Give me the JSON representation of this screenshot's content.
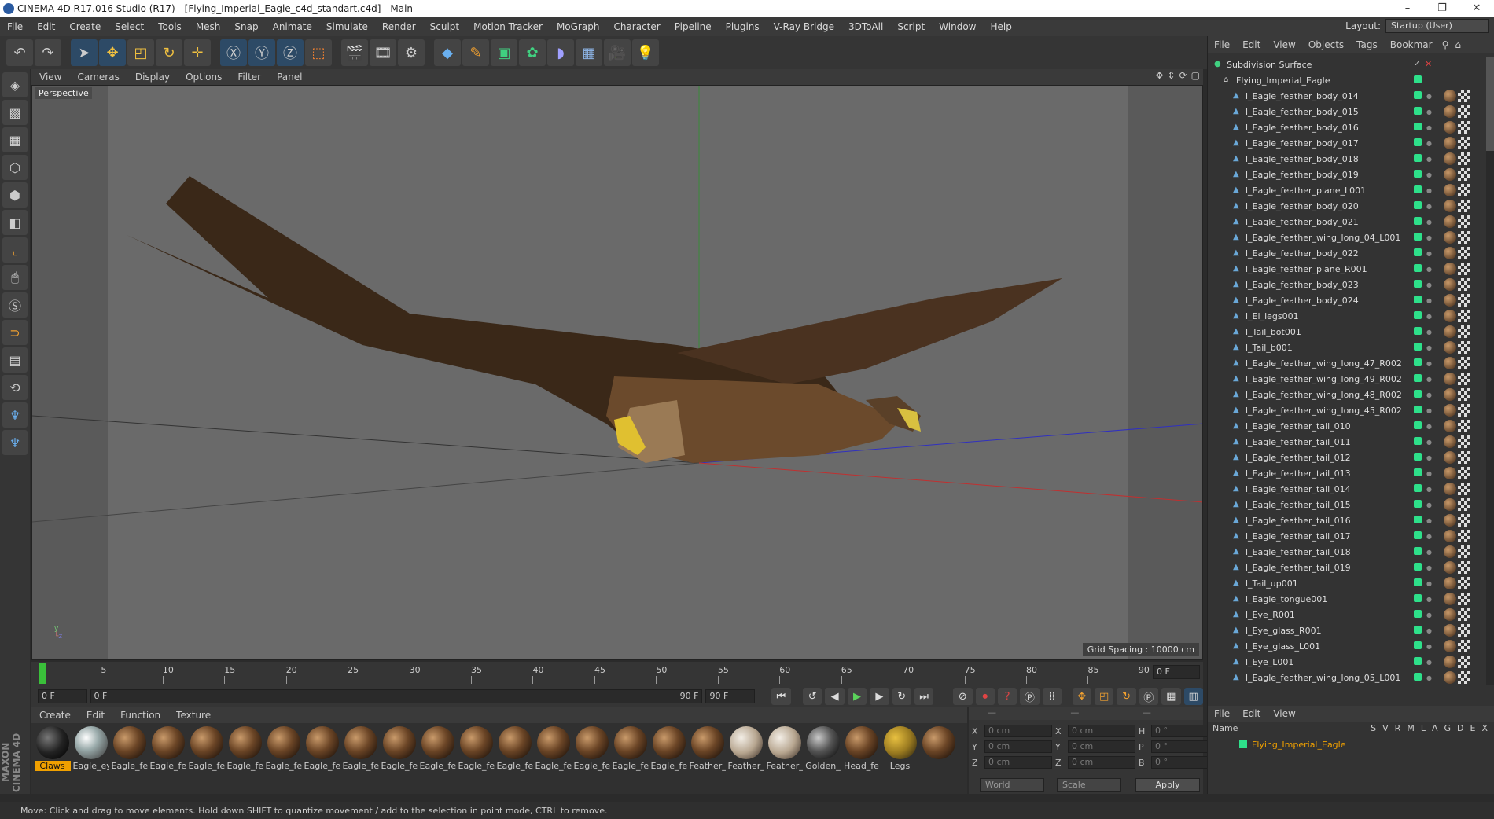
{
  "window": {
    "title": "CINEMA 4D R17.016 Studio (R17) - [Flying_Imperial_Eagle_c4d_standart.c4d] - Main",
    "minimize": "–",
    "restore": "❐",
    "close": "✕"
  },
  "menu": [
    "File",
    "Edit",
    "Create",
    "Select",
    "Tools",
    "Mesh",
    "Snap",
    "Animate",
    "Simulate",
    "Render",
    "Sculpt",
    "Motion Tracker",
    "MoGraph",
    "Character",
    "Pipeline",
    "Plugins",
    "V-Ray Bridge",
    "3DToAll",
    "Script",
    "Window",
    "Help"
  ],
  "layout": {
    "label": "Layout:",
    "value": "Startup (User)"
  },
  "viewport": {
    "menu": [
      "View",
      "Cameras",
      "Display",
      "Options",
      "Filter",
      "Panel"
    ],
    "label": "Perspective",
    "grid_spacing": "Grid Spacing : 10000 cm"
  },
  "timeline": {
    "ticks": [
      "0",
      "5",
      "10",
      "15",
      "20",
      "25",
      "30",
      "35",
      "40",
      "45",
      "50",
      "55",
      "60",
      "65",
      "70",
      "75",
      "80",
      "85",
      "90"
    ],
    "current_frame": "0 F"
  },
  "transport": {
    "start": "0 F",
    "range_start": "0 F",
    "range_end": "90 F",
    "end": "90 F"
  },
  "materials": {
    "menu": [
      "Create",
      "Edit",
      "Function",
      "Texture"
    ],
    "items": [
      {
        "label": "Claws",
        "style": "dark",
        "selected": true
      },
      {
        "label": "Eagle_ey",
        "style": "glass"
      },
      {
        "label": "Eagle_fe",
        "style": "brown"
      },
      {
        "label": "Eagle_fe",
        "style": "brown"
      },
      {
        "label": "Eagle_fe",
        "style": "brown"
      },
      {
        "label": "Eagle_fe",
        "style": "brown"
      },
      {
        "label": "Eagle_fe",
        "style": "brown"
      },
      {
        "label": "Eagle_fe",
        "style": "brown"
      },
      {
        "label": "Eagle_fe",
        "style": "brown"
      },
      {
        "label": "Eagle_fe",
        "style": "brown"
      },
      {
        "label": "Eagle_fe",
        "style": "brown"
      },
      {
        "label": "Eagle_fe",
        "style": "brown"
      },
      {
        "label": "Eagle_fe",
        "style": "brown"
      },
      {
        "label": "Eagle_fe",
        "style": "brown"
      },
      {
        "label": "Eagle_fe",
        "style": "brown"
      },
      {
        "label": "Eagle_fe",
        "style": "brown"
      },
      {
        "label": "Eagle_fe",
        "style": "brown"
      },
      {
        "label": "Feather_",
        "style": "brown"
      },
      {
        "label": "Feather_",
        "style": "light"
      },
      {
        "label": "Feather_",
        "style": "light"
      },
      {
        "label": "Golden_",
        "style": "golden"
      },
      {
        "label": "Head_fe",
        "style": "brown"
      },
      {
        "label": "Legs",
        "style": "legs"
      },
      {
        "label": "",
        "style": "brown"
      }
    ]
  },
  "coords": {
    "rows": [
      {
        "a": "X",
        "v1": "0 cm",
        "b": "X",
        "v2": "0 cm",
        "c": "H",
        "v3": "0 °"
      },
      {
        "a": "Y",
        "v1": "0 cm",
        "b": "Y",
        "v2": "0 cm",
        "c": "P",
        "v3": "0 °"
      },
      {
        "a": "Z",
        "v1": "0 cm",
        "b": "Z",
        "v2": "0 cm",
        "c": "B",
        "v3": "0 °"
      }
    ],
    "world": "World",
    "scale": "Scale",
    "apply": "Apply"
  },
  "objects": {
    "menu": [
      "File",
      "Edit",
      "View",
      "Objects",
      "Tags",
      "Bookmar"
    ],
    "root": "Subdivision Surface",
    "child": "Flying_Imperial_Eagle",
    "items": [
      "l_Eagle_feather_body_014",
      "l_Eagle_feather_body_015",
      "l_Eagle_feather_body_016",
      "l_Eagle_feather_body_017",
      "l_Eagle_feather_body_018",
      "l_Eagle_feather_body_019",
      "l_Eagle_feather_plane_L001",
      "l_Eagle_feather_body_020",
      "l_Eagle_feather_body_021",
      "l_Eagle_feather_wing_long_04_L001",
      "l_Eagle_feather_body_022",
      "l_Eagle_feather_plane_R001",
      "l_Eagle_feather_body_023",
      "l_Eagle_feather_body_024",
      "l_El_legs001",
      "l_Tail_bot001",
      "l_Tail_b001",
      "l_Eagle_feather_wing_long_47_R002",
      "l_Eagle_feather_wing_long_49_R002",
      "l_Eagle_feather_wing_long_48_R002",
      "l_Eagle_feather_wing_long_45_R002",
      "l_Eagle_feather_tail_010",
      "l_Eagle_feather_tail_011",
      "l_Eagle_feather_tail_012",
      "l_Eagle_feather_tail_013",
      "l_Eagle_feather_tail_014",
      "l_Eagle_feather_tail_015",
      "l_Eagle_feather_tail_016",
      "l_Eagle_feather_tail_017",
      "l_Eagle_feather_tail_018",
      "l_Eagle_feather_tail_019",
      "l_Tail_up001",
      "l_Eagle_tongue001",
      "l_Eye_R001",
      "l_Eye_glass_R001",
      "l_Eye_glass_L001",
      "l_Eye_L001",
      "l_Eagle_feather_wing_long_05_L001"
    ]
  },
  "attributes": {
    "menu": [
      "File",
      "Edit",
      "View"
    ],
    "name_col": "Name",
    "cols": [
      "S",
      "V",
      "R",
      "M",
      "L",
      "A",
      "G",
      "D",
      "E",
      "X"
    ],
    "row": "Flying_Imperial_Eagle"
  },
  "status": "Move: Click and drag to move elements. Hold down SHIFT to quantize movement / add to the selection in point mode, CTRL to remove.",
  "brand": "MAXON CINEMA 4D",
  "toolbar_icons": [
    "undo-icon",
    "redo-icon",
    "select-icon",
    "move-icon",
    "scale-icon",
    "rotate-icon",
    "live-icon",
    "x-axis-icon",
    "y-axis-icon",
    "z-axis-icon",
    "coord-icon",
    "render-view-icon",
    "render-icon",
    "render-settings-icon",
    "cube-icon",
    "pen-icon",
    "generator-icon",
    "cloner-icon",
    "deformer-icon",
    "floor-icon",
    "camera-icon",
    "light-icon"
  ],
  "colors": {
    "accent": "#f0a000",
    "visible": "#2ee08a"
  }
}
